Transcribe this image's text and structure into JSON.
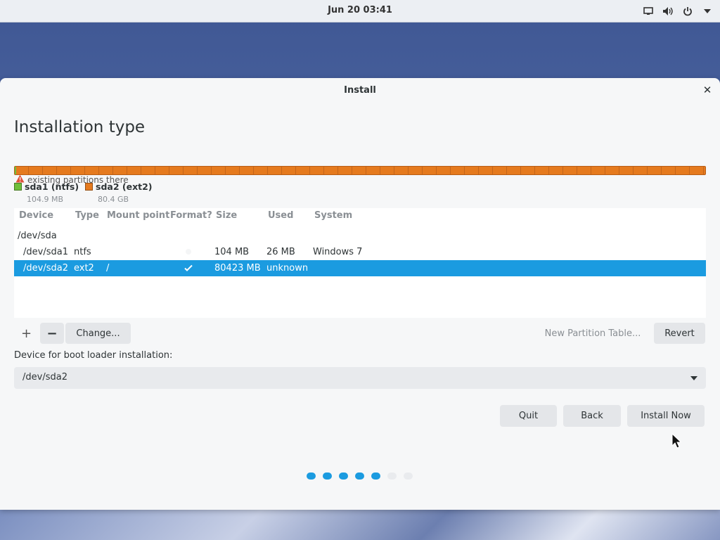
{
  "topbar": {
    "clock": "Jun 20  03:41",
    "icons": [
      "display-icon",
      "volume-icon",
      "power-icon",
      "menu-down-icon"
    ]
  },
  "window": {
    "title": "Install",
    "heading": "Installation type"
  },
  "partitions": {
    "warning_text": "existing partitions there",
    "legend": [
      {
        "name": "sda1 (ntfs)",
        "size": "104.9 MB",
        "color": "#6fbe3a"
      },
      {
        "name": "sda2 (ext2)",
        "size": "80.4 GB",
        "color": "#e57a1e"
      }
    ]
  },
  "table": {
    "headers": {
      "device": "Device",
      "type": "Type",
      "mount": "Mount point",
      "format": "Format?",
      "size": "Size",
      "used": "Used",
      "system": "System"
    },
    "group": "/dev/sda",
    "rows": [
      {
        "device": "/dev/sda1",
        "type": "ntfs",
        "mount": "",
        "format": false,
        "size": "104 MB",
        "used": "26 MB",
        "system": "Windows 7",
        "selected": false
      },
      {
        "device": "/dev/sda2",
        "type": "ext2",
        "mount": "/",
        "format": true,
        "size": "80423 MB",
        "used": "unknown",
        "system": "",
        "selected": true
      }
    ]
  },
  "toolbar": {
    "add_label": "+",
    "remove_label": "−",
    "change_label": "Change...",
    "new_table_label": "New Partition Table...",
    "revert_label": "Revert"
  },
  "bootloader": {
    "label": "Device for boot loader installation:",
    "value": "/dev/sda2"
  },
  "buttons": {
    "quit": "Quit",
    "back": "Back",
    "install": "Install Now"
  },
  "progress": {
    "total_steps": 7,
    "completed_steps": 5
  },
  "colors": {
    "accent": "#1b9be0",
    "sda1": "#6fbe3a",
    "sda2": "#e57a1e"
  }
}
